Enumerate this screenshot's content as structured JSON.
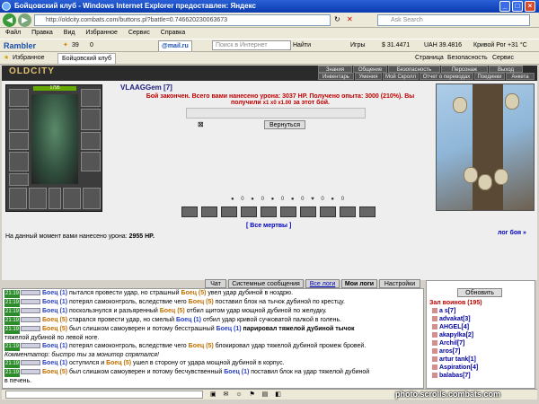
{
  "window": {
    "title": "Бойцовский клуб - Windows Internet Explorer предоставлен: Яндекс",
    "address": "http://oldcity.combats.com/buttons.pl?battle=0.746620230063673",
    "search_placeholder": "Ask Search"
  },
  "menu": [
    "Файл",
    "Правка",
    "Вид",
    "Избранное",
    "Сервис",
    "Справка"
  ],
  "toolbar": {
    "rambler": "Rambler",
    "count1": "39",
    "count2": "0",
    "mail": "@mail.ru",
    "search_placeholder": "Поиск в Интернет",
    "find_label": "Найти",
    "games": "Игры",
    "usd": "$ 31.4471",
    "uah": "UAH 39.4816",
    "weather": "Кривой Рог +31 °C"
  },
  "tabbar": {
    "favorites": "Избранное",
    "tab_title": "Бойцовский клуб",
    "page": "Страница",
    "safety": "Безопасность",
    "service": "Сервис"
  },
  "game": {
    "logo": "OLDCITY",
    "nav_top": [
      "Знания",
      "Общение",
      "Безопасность",
      "Персонаж",
      "Выход"
    ],
    "nav_bottom": [
      "Инвентарь",
      "Умения",
      "Мой Скролл",
      "Отчет о переводах",
      "Поединки",
      "Анкета"
    ]
  },
  "player": {
    "hp": "1795",
    "name": "VLAAGGem",
    "level": "[7]"
  },
  "battle": {
    "result_line1": "Бой закончен. Всего вами нанесено урона: 3037 HP. Получено опыта: 3000 (210%). Вы",
    "result_line2": "получили",
    "result_coins": "x1 x0 x1.00",
    "result_end": "за этот бой.",
    "return_btn": "Вернуться",
    "all_dead": "[ Все мертвы ]",
    "log_link": "лог боя »",
    "damage_label": "На данный момент вами нанесено урона:",
    "damage_value": "2955 HP."
  },
  "chat_tabs": [
    "Чат",
    "Системные сообщения",
    "Все логи",
    "Мои логи",
    "Настройки"
  ],
  "chat": [
    {
      "time": "21:19",
      "a": "Боец",
      "al": "(1)",
      "b": "Боец",
      "bl": "(5)",
      "text1": "пытался провести удар, но страшный",
      "text2": "увел удар дубиной в ноздрю.",
      "cont": ""
    },
    {
      "time": "21:19",
      "a": "Боец",
      "al": "(1)",
      "b": "Боец",
      "bl": "(5)",
      "text1": "потерял самоконтроль, вследствие чего",
      "text2": "поставил блок на тычок дубиной по крестцу.",
      "cont": ""
    },
    {
      "time": "21:19",
      "a": "Боец",
      "al": "(1)",
      "b": "Боец",
      "bl": "(5)",
      "text1": "поскользнулся и разъяренный",
      "text2": "отбил щитом удар мощной дубиной по желудку.",
      "cont": ""
    },
    {
      "time": "21:19",
      "a": "Боец",
      "al": "(5)",
      "b": "Боец",
      "bl": "(1)",
      "text1": "старался провести удар, но смелый",
      "text2": "отбил удар кривой сучковатой палкой в голень.",
      "cont": ""
    },
    {
      "time": "21:19",
      "a": "Боец",
      "al": "(5)",
      "b": "Боец",
      "bl": "(1)",
      "text1": "был слишком самоуверен и потому бесстрашный",
      "text2": "парировал тяжелой дубиной тычок",
      "cont": "тяжелой дубиной по левой ноге."
    },
    {
      "time": "21:19",
      "a": "Боец",
      "al": "(1)",
      "b": "Боец",
      "bl": "(5)",
      "text1": "потерял самоконтроль, вследствие чего",
      "text2": "блокировал удар тяжелой дубиной промеж бровей.",
      "cont": ""
    },
    {
      "time": "",
      "a": "",
      "al": "",
      "b": "",
      "bl": "",
      "text1": "Комментатор: быстро ты за монитор спрятался!",
      "text2": "",
      "cont": ""
    },
    {
      "time": "21:19",
      "a": "Боец",
      "al": "(1)",
      "b": "Боец",
      "bl": "(5)",
      "text1": "оступился и",
      "text2": "ушел в сторону от удара мощной дубиной в корпус.",
      "cont": ""
    },
    {
      "time": "21:19",
      "a": "Боец",
      "al": "(5)",
      "b": "Боец",
      "bl": "(1)",
      "text1": "был слишком самоуверен и потому бесчувственный",
      "text2": "поставил блок на удар тяжелой дубиной",
      "cont": "в печень."
    }
  ],
  "online": {
    "refresh_btn": "Обновить",
    "header": "Зал воинов (195)",
    "users": [
      "a s[7]",
      "advakat[3]",
      "AHGEL[4]",
      "akapylka[2]",
      "Archil[7]",
      "aros[7]",
      "artur tank[1]",
      "Aspiration[4]",
      "balabas[7]"
    ]
  },
  "watermark": "photo.scrolls.combats.com"
}
